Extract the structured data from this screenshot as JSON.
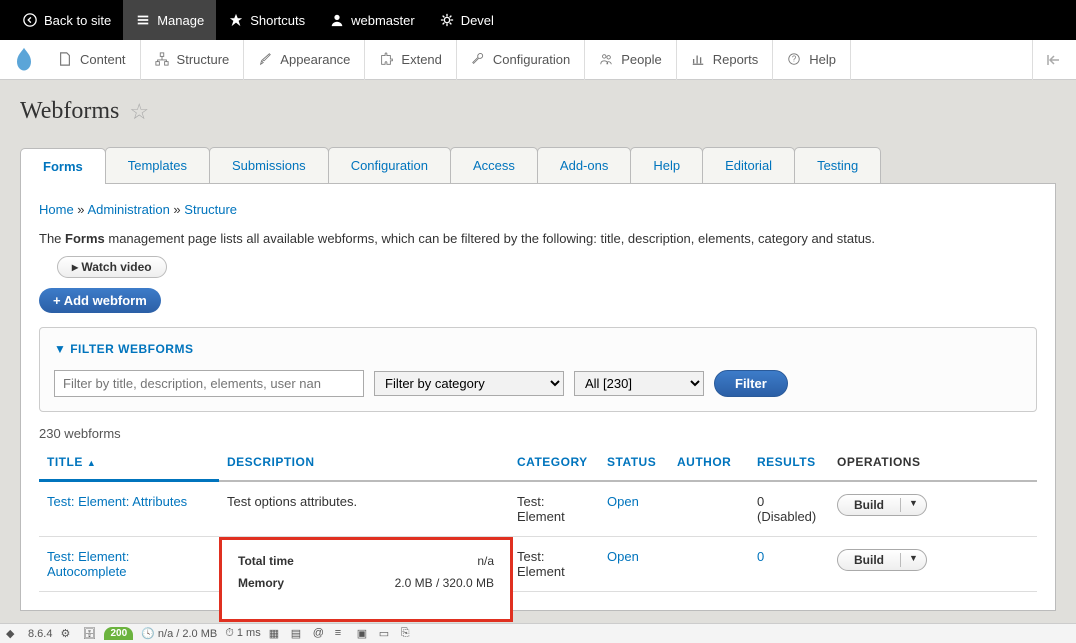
{
  "topbar": {
    "back": "Back to site",
    "manage": "Manage",
    "shortcuts": "Shortcuts",
    "user": "webmaster",
    "devel": "Devel"
  },
  "adminbar": {
    "content": "Content",
    "structure": "Structure",
    "appearance": "Appearance",
    "extend": "Extend",
    "configuration": "Configuration",
    "people": "People",
    "reports": "Reports",
    "help": "Help"
  },
  "page_title": "Webforms",
  "tabs": [
    "Forms",
    "Templates",
    "Submissions",
    "Configuration",
    "Access",
    "Add-ons",
    "Help",
    "Editorial",
    "Testing"
  ],
  "breadcrumb": {
    "home": "Home",
    "admin": "Administration",
    "structure": "Structure",
    "sep": " » "
  },
  "description_prefix": "The ",
  "description_bold": "Forms",
  "description_rest": " management page lists all available webforms, which can be filtered by the following: title, description, elements, category and status.",
  "watch_video": "▸ Watch video",
  "add_webform": "+ Add webform",
  "filter": {
    "heading": "▼  FILTER WEBFORMS",
    "placeholder": "Filter by title, description, elements, user nan",
    "category": "Filter by category",
    "state": "All [230]",
    "button": "Filter"
  },
  "count": "230 webforms",
  "columns": {
    "title": "TITLE",
    "description": "DESCRIPTION",
    "category": "CATEGORY",
    "status": "STATUS",
    "author": "AUTHOR",
    "results": "RESULTS",
    "operations": "OPERATIONS"
  },
  "rows": [
    {
      "title": "Test: Element: Attributes",
      "description": "Test options attributes.",
      "category": "Test: Element",
      "status": "Open",
      "results": "0 (Disabled)",
      "op": "Build"
    },
    {
      "title": "Test: Element: Autocomplete",
      "description": "",
      "category": "Test: Element",
      "status": "Open",
      "results": "0",
      "op": "Build"
    }
  ],
  "tooltip": {
    "k1": "Total time",
    "v1": "n/a",
    "k2": "Memory",
    "v2": "2.0 MB / 320.0 MB"
  },
  "statusbar": {
    "version": "8.6.4",
    "code": "200",
    "mem": "n/a / 2.0 MB",
    "time": "1 ms"
  }
}
